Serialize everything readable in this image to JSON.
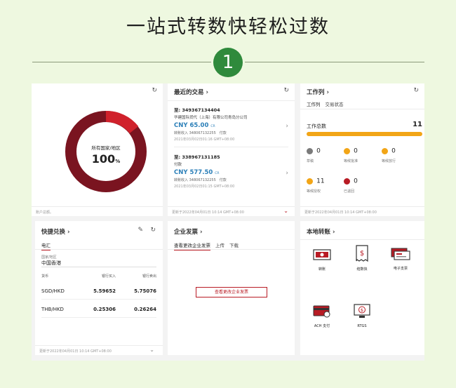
{
  "header": {
    "title": "一站式转数快轻松过数",
    "step": "1"
  },
  "overview": {
    "center_label": "所有国家/地区",
    "center_value": "100",
    "center_unit": "%",
    "footnote": "账户总额。"
  },
  "recent": {
    "title": "最近的交易 ›",
    "items": [
      {
        "to": "至: 349367134404",
        "name": "华建国际货代（上海）有限公司青岛分公司",
        "amount": "CNY 65.00",
        "unit": "CR",
        "account": "转账收入 348067132255",
        "type": "付款",
        "date": "2021年03月02日01:16 GMT+08:00"
      },
      {
        "to": "至: 338967131185",
        "name": "付款",
        "amount": "CNY 577.50",
        "unit": "CR",
        "account": "转账收入 348067132255",
        "type": "付款",
        "date": "2021年03月02日01:15 GMT+08:00"
      }
    ],
    "updated": "更新于2022年04月01日 10:14 GMT+08:00"
  },
  "worklist": {
    "title": "工作列 ›",
    "tabs": [
      "工作列",
      "交易状态"
    ],
    "total_label": "工作总数",
    "total_value": "11",
    "stats": [
      {
        "label": "草稿",
        "value": "0",
        "color": "#7a7a7a"
      },
      {
        "label": "等候批准",
        "value": "0",
        "color": "#f2a516"
      },
      {
        "label": "等候放行",
        "value": "0",
        "color": "#f2a516"
      },
      {
        "label": "等候授权",
        "value": "11",
        "color": "#f2a516"
      },
      {
        "label": "已退回",
        "value": "0",
        "color": "#b81b24"
      }
    ],
    "updated": "更新于2022年04月01日 10:14 GMT+08:00"
  },
  "fx": {
    "title": "快捷兑换 ›",
    "tab": "电汇",
    "region_label": "国家/地区",
    "region_value": "中国香港",
    "headers": [
      "货币",
      "银行买入",
      "银行卖出"
    ],
    "rows": [
      {
        "pair": "SGD/HKD",
        "buy": "5.59652",
        "sell": "5.75076"
      },
      {
        "pair": "THB/HKD",
        "buy": "0.25306",
        "sell": "0.26264"
      }
    ],
    "updated": "更新于2022年04月01日 10:14 GMT+08:00"
  },
  "invoice": {
    "title": "企业发票 ›",
    "tabs": [
      "查看更改企业发票",
      "上传",
      "下载"
    ],
    "button": "查看更改企业发票"
  },
  "payments": {
    "title": "本地转账 ›",
    "items": [
      {
        "label": "转账",
        "icon": "cash-icon"
      },
      {
        "label": "结数快",
        "icon": "receipt-icon"
      },
      {
        "label": "电子支票",
        "icon": "cheque-icon"
      },
      {
        "label": "ACH 支付",
        "icon": "card-icon"
      },
      {
        "label": "RTGS",
        "icon": "monitor-icon"
      }
    ]
  },
  "colors": {
    "brand_red": "#b81b24",
    "donut_dark": "#7a1420",
    "progress": "#f2a516",
    "step_green": "#2f8a3c"
  }
}
